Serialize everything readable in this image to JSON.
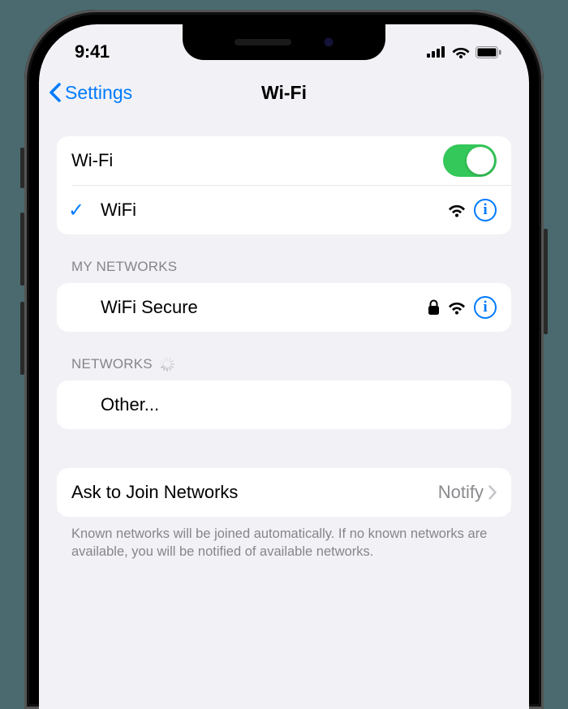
{
  "status": {
    "time": "9:41"
  },
  "nav": {
    "back_label": "Settings",
    "title": "Wi-Fi"
  },
  "wifi": {
    "toggle_label": "Wi-Fi",
    "toggle_on": true,
    "connected": {
      "name": "WiFi"
    }
  },
  "my_networks": {
    "header": "MY NETWORKS",
    "items": [
      {
        "name": "WiFi Secure",
        "locked": true
      }
    ]
  },
  "other_networks": {
    "header": "NETWORKS",
    "other_label": "Other..."
  },
  "ask_join": {
    "label": "Ask to Join Networks",
    "value": "Notify",
    "footer": "Known networks will be joined automatically. If no known networks are available, you will be notified of available networks."
  }
}
